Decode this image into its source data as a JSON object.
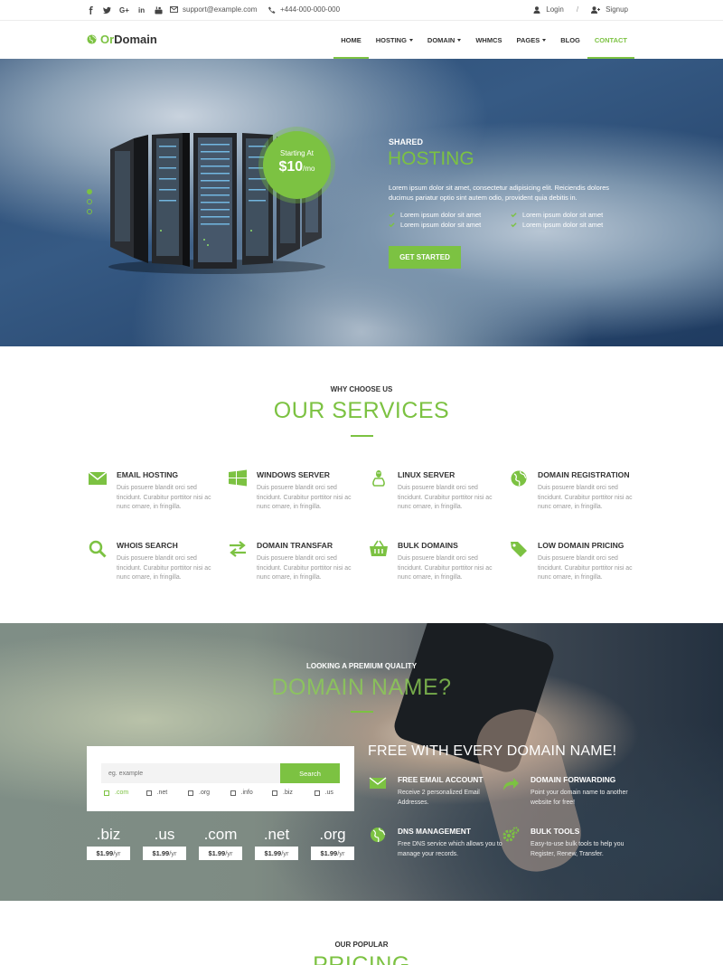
{
  "topbar": {
    "social_icons": [
      "facebook-icon",
      "twitter-icon",
      "google-plus-icon",
      "linkedin-icon",
      "youtube-icon"
    ],
    "email": "support@example.com",
    "phone": "+444-000-000-000",
    "login": "Login",
    "signup": "Signup",
    "separator": "/"
  },
  "logo": {
    "part1": "Or",
    "part2": "Domain"
  },
  "nav": {
    "home": "HOME",
    "hosting": "HOSTING",
    "domain": "DOMAIN",
    "whmcs": "WHMCS",
    "pages": "PAGES",
    "blog": "BLOG",
    "contact": "CONTACT"
  },
  "hero": {
    "badge_line1": "Starting At",
    "badge_price": "$10",
    "badge_unit": "/mo",
    "kicker": "SHARED",
    "headline": "HOSTING",
    "description": "Lorem ipsum dolor sit amet, consectetur adipisicing elit. Reiciendis dolores ducimus pariatur optio sint autem odio, provident quia debitis in.",
    "features": [
      "Lorem ipsum dolor sit amet",
      "Lorem ipsum dolor sit amet",
      "Lorem ipsum dolor sit amet",
      "Lorem ipsum dolor sit amet"
    ],
    "cta": "GET STARTED",
    "slide_count": 3,
    "active_slide": 1
  },
  "services": {
    "kicker": "WHY CHOOSE US",
    "title": "OUR SERVICES",
    "items": [
      {
        "title": "EMAIL HOSTING",
        "icon": "envelope-icon",
        "desc": "Duis posuere blandit orci sed tincidunt. Curabitur porttitor nisi ac nunc ornare, in fringilla."
      },
      {
        "title": "WINDOWS SERVER",
        "icon": "windows-icon",
        "desc": "Duis posuere blandit orci sed tincidunt. Curabitur porttitor nisi ac nunc ornare, in fringilla."
      },
      {
        "title": "LINUX SERVER",
        "icon": "linux-icon",
        "desc": "Duis posuere blandit orci sed tincidunt. Curabitur porttitor nisi ac nunc ornare, in fringilla."
      },
      {
        "title": "DOMAIN REGISTRATION",
        "icon": "globe-icon",
        "desc": "Duis posuere blandit orci sed tincidunt. Curabitur porttitor nisi ac nunc ornare, in fringilla."
      },
      {
        "title": "WHOIS SEARCH",
        "icon": "search-icon",
        "desc": "Duis posuere blandit orci sed tincidunt. Curabitur porttitor nisi ac nunc ornare, in fringilla."
      },
      {
        "title": "DOMAIN TRANSFAR",
        "icon": "exchange-icon",
        "desc": "Duis posuere blandit orci sed tincidunt. Curabitur porttitor nisi ac nunc ornare, in fringilla."
      },
      {
        "title": "BULK DOMAINS",
        "icon": "basket-icon",
        "desc": "Duis posuere blandit orci sed tincidunt. Curabitur porttitor nisi ac nunc ornare, in fringilla."
      },
      {
        "title": "LOW DOMAIN PRICING",
        "icon": "tag-icon",
        "desc": "Duis posuere blandit orci sed tincidunt. Curabitur porttitor nisi ac nunc ornare, in fringilla."
      }
    ]
  },
  "domain": {
    "kicker": "LOOKING A PREMIUM QUALITY",
    "title": "DOMAIN NAME?",
    "search_placeholder": "eg. example",
    "search_button": "Search",
    "tlds": [
      ".com",
      ".net",
      ".org",
      ".info",
      ".biz",
      ".us"
    ],
    "selected_tld": ".com",
    "prices": [
      {
        "ext": ".biz",
        "price": "$1.99",
        "unit": "/yr"
      },
      {
        "ext": ".us",
        "price": "$1.99",
        "unit": "/yr"
      },
      {
        "ext": ".com",
        "price": "$1.99",
        "unit": "/yr"
      },
      {
        "ext": ".net",
        "price": "$1.99",
        "unit": "/yr"
      },
      {
        "ext": ".org",
        "price": "$1.99",
        "unit": "/yr"
      }
    ],
    "free_title": "FREE WITH EVERY DOMAIN NAME!",
    "features": [
      {
        "title": "FREE EMAIL ACCOUNT",
        "icon": "envelope-icon",
        "desc": "Receive 2 personalized Email Addresses."
      },
      {
        "title": "DOMAIN FORWARDING",
        "icon": "share-arrow-icon",
        "desc": "Point your domain name to another website for free!"
      },
      {
        "title": "DNS MANAGEMENT",
        "icon": "globe-icon",
        "desc": "Free DNS service which allows you to manage your records."
      },
      {
        "title": "BULK TOOLS",
        "icon": "gears-icon",
        "desc": "Easy-to-use bulk tools to help you Register, Renew, Transfer."
      }
    ]
  },
  "pricing": {
    "kicker": "OUR POPULAR",
    "title": "PRICING"
  },
  "colors": {
    "accent": "#7cc242",
    "text": "#333333",
    "muted": "#999999"
  }
}
